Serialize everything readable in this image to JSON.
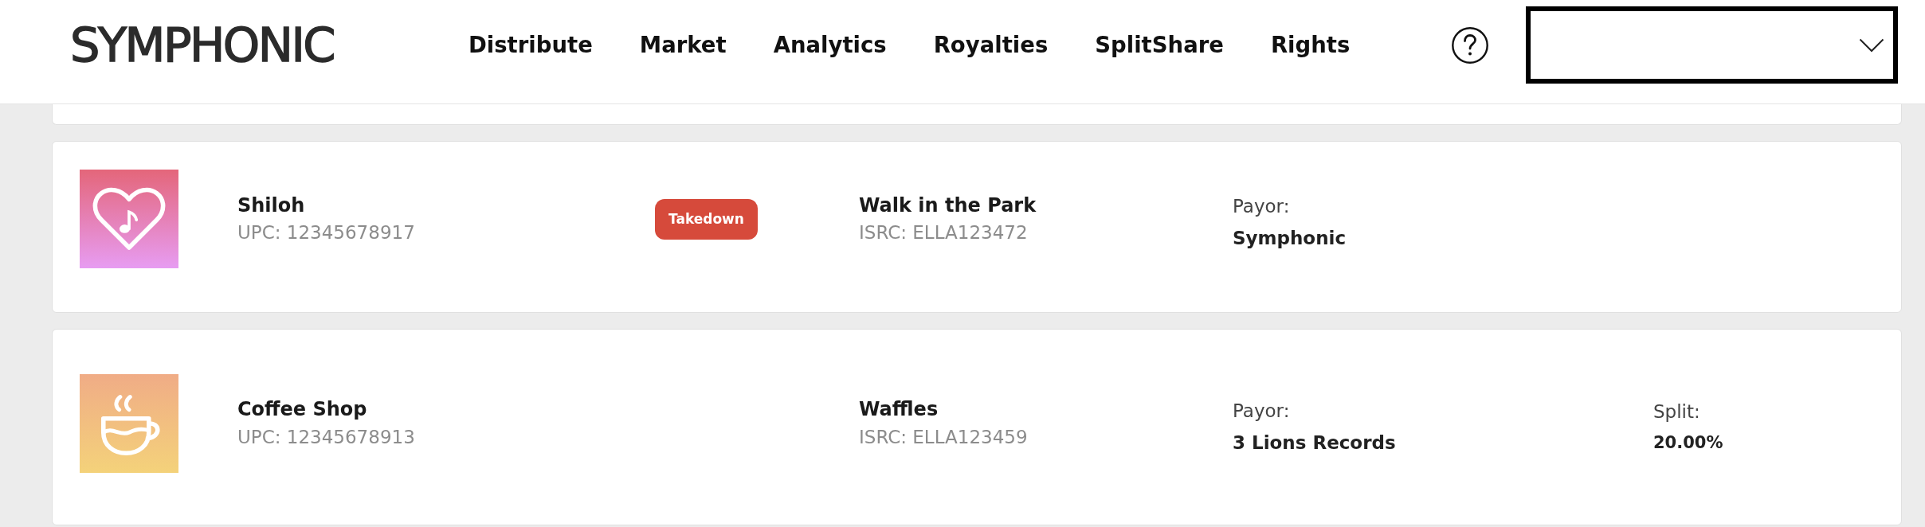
{
  "header": {
    "logo": "SYMPHONIC",
    "nav": [
      "Distribute",
      "Market",
      "Analytics",
      "Royalties",
      "SplitShare",
      "Rights"
    ]
  },
  "releases": [
    {
      "title": "Shiloh",
      "upc": "UPC: 12345678917",
      "artwork": {
        "kind": "heart"
      },
      "status": {
        "kind": "takedown",
        "label": "Takedown"
      },
      "track": {
        "title": "Walk in the Park",
        "isrc": "ISRC: ELLA123472"
      },
      "payor": {
        "label": "Payor:",
        "value": "Symphonic"
      }
    },
    {
      "title": "Coffee Shop",
      "upc": "UPC: 12345678913",
      "artwork": {
        "kind": "cup"
      },
      "track": {
        "title": "Waffles",
        "isrc": "ISRC: ELLA123459"
      },
      "payor": {
        "label": "Payor:",
        "value": "3 Lions Records"
      },
      "split": {
        "label": "Split:",
        "value": "20.00%"
      }
    }
  ]
}
